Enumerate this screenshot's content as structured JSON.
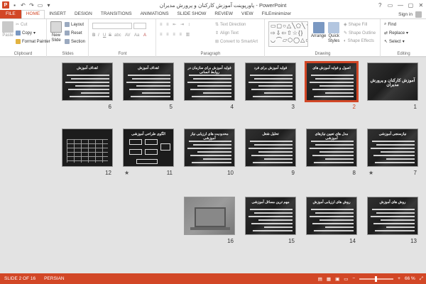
{
  "window": {
    "title": "پاورپوینت آموزش کارکنان و پرورش مدیران - PowerPoint",
    "app_icon": "P",
    "controls": [
      "?",
      "▭",
      "—",
      "▢",
      "✕"
    ]
  },
  "tabs": [
    "FILE",
    "HOME",
    "INSERT",
    "DESIGN",
    "TRANSITIONS",
    "ANIMATIONS",
    "SLIDE SHOW",
    "REVIEW",
    "VIEW",
    "FILEminimizer"
  ],
  "active_tab": "HOME",
  "signin": "Sign in",
  "ribbon": {
    "clipboard": {
      "label": "Clipboard",
      "paste": "Paste",
      "cut": "Cut",
      "copy": "Copy",
      "format_painter": "Format Painter"
    },
    "slides": {
      "label": "Slides",
      "new_slide": "New",
      "new_slide_2": "Slide",
      "layout": "Layout",
      "reset": "Reset",
      "section": "Section"
    },
    "font": {
      "label": "Font",
      "bold": "B",
      "italic": "I",
      "underline": "U",
      "strike": "S",
      "shadow": "abc",
      "spacing": "AV",
      "case": "Aa",
      "color": "A"
    },
    "paragraph": {
      "label": "Paragraph",
      "text_direction": "Text Direction",
      "align_text": "Align Text",
      "smartart": "Convert to SmartArt"
    },
    "drawing": {
      "label": "Drawing",
      "arrange": "Arrange",
      "quick_styles": "Quick",
      "quick_styles_2": "Styles",
      "shape_fill": "Shape Fill",
      "shape_outline": "Shape Outline",
      "shape_effects": "Shape Effects",
      "shapes_glyphs": "▭▢○△╲⬠╲↘◻ ⇨⇩⇦⇧☆{} ◡⌒▱⬡◯△▭"
    },
    "editing": {
      "label": "Editing",
      "find": "Find",
      "replace": "Replace",
      "select": "Select"
    }
  },
  "slides": [
    {
      "num": "1",
      "title": "آموزش کارکنان و پرورش مدیران",
      "kind": "title"
    },
    {
      "num": "2",
      "title": "اصول و فواید آموزش های",
      "kind": "text",
      "selected": true
    },
    {
      "num": "3",
      "title": "فواید آموزش برای فرد",
      "kind": "text"
    },
    {
      "num": "4",
      "title": "فواید آموزش برای سازمان در روابط انسانی",
      "kind": "text"
    },
    {
      "num": "5",
      "title": "اهداف آموزش",
      "kind": "text"
    },
    {
      "num": "6",
      "title": "اهداف آموزش",
      "kind": "text"
    },
    {
      "num": "7",
      "title": "نیازسنجی آموزشی",
      "kind": "text",
      "star": true
    },
    {
      "num": "8",
      "title": "مدل های تعیین نیازهای آموزشی",
      "kind": "text"
    },
    {
      "num": "9",
      "title": "تحلیل شغل",
      "kind": "text"
    },
    {
      "num": "10",
      "title": "محدودیت های ارزیابی نیاز آموزشی",
      "kind": "text"
    },
    {
      "num": "11",
      "title": "الگوی طراحی آموزشی",
      "kind": "diagram",
      "star": true
    },
    {
      "num": "12",
      "title": "",
      "kind": "table"
    },
    {
      "num": "13",
      "title": "روش های آموزش",
      "kind": "text"
    },
    {
      "num": "14",
      "title": "روش های ارزیابی آموزش",
      "kind": "text"
    },
    {
      "num": "15",
      "title": "مهم ترین مسائل آموزشی",
      "kind": "text"
    },
    {
      "num": "16",
      "title": "",
      "kind": "photo"
    }
  ],
  "status": {
    "slide": "SLIDE 2 OF 16",
    "language": "PERSIAN",
    "zoom": "66 %",
    "zoom_minus": "−",
    "zoom_plus": "+",
    "view_icons": [
      "▤",
      "▦",
      "▣",
      "▭"
    ]
  }
}
